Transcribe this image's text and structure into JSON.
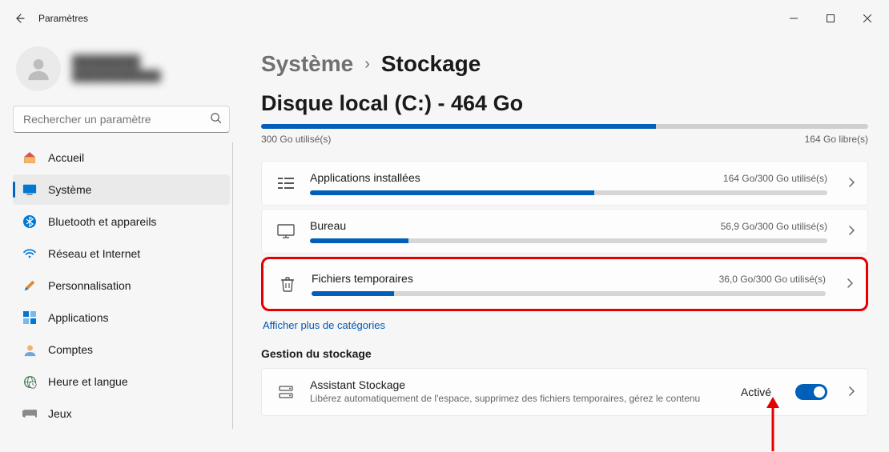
{
  "window": {
    "title": "Paramètres"
  },
  "user": {
    "display_name": "████████",
    "secondary": "████████████"
  },
  "search": {
    "placeholder": "Rechercher un paramètre"
  },
  "sidebar": {
    "items": [
      {
        "label": "Accueil"
      },
      {
        "label": "Système"
      },
      {
        "label": "Bluetooth et appareils"
      },
      {
        "label": "Réseau et Internet"
      },
      {
        "label": "Personnalisation"
      },
      {
        "label": "Applications"
      },
      {
        "label": "Comptes"
      },
      {
        "label": "Heure et langue"
      },
      {
        "label": "Jeux"
      }
    ]
  },
  "breadcrumb": {
    "parent": "Système",
    "current": "Stockage"
  },
  "disk": {
    "title": "Disque local (C:) - 464 Go",
    "used_label": "300 Go utilisé(s)",
    "free_label": "164 Go libre(s)",
    "used_percent": 65
  },
  "categories": [
    {
      "label": "Applications installées",
      "usage": "164 Go/300 Go utilisé(s)",
      "percent": 55
    },
    {
      "label": "Bureau",
      "usage": "56,9 Go/300 Go utilisé(s)",
      "percent": 19
    },
    {
      "label": "Fichiers temporaires",
      "usage": "36,0 Go/300 Go utilisé(s)",
      "percent": 16
    }
  ],
  "show_more": "Afficher plus de catégories",
  "storage_mgmt": {
    "heading": "Gestion du stockage",
    "assistant": {
      "title": "Assistant Stockage",
      "desc": "Libérez automatiquement de l'espace, supprimez des fichiers temporaires, gérez le contenu",
      "status": "Activé"
    }
  },
  "colors": {
    "accent": "#005fb8",
    "highlight": "#e40000"
  }
}
